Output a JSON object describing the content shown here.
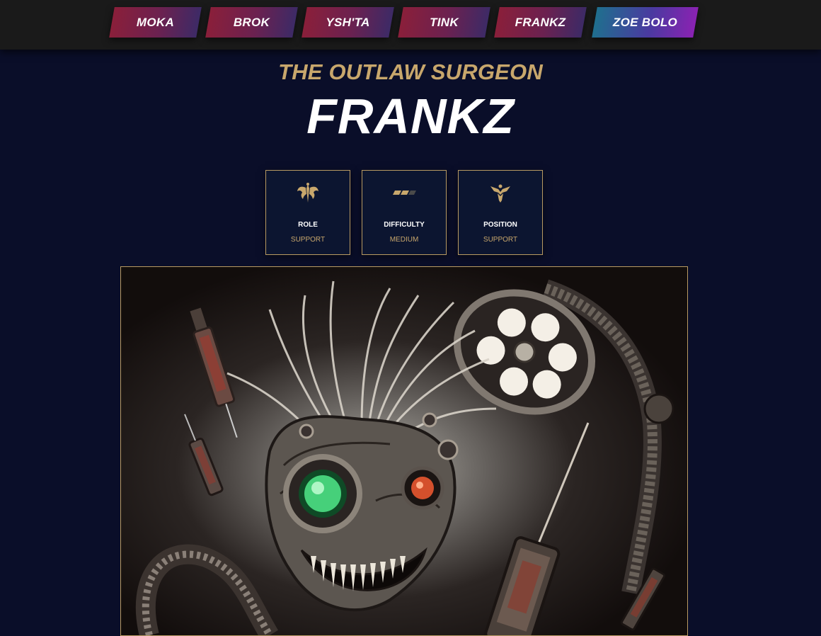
{
  "nav": {
    "tabs": [
      {
        "label": "MOKA"
      },
      {
        "label": "BROK"
      },
      {
        "label": "YSH'TA"
      },
      {
        "label": "TINK"
      },
      {
        "label": "FRANKZ"
      },
      {
        "label": "ZOE BOLO"
      }
    ]
  },
  "hero": {
    "subtitle": "THE OUTLAW SURGEON",
    "name": "FRANKZ"
  },
  "stats": [
    {
      "label": "ROLE",
      "value": "SUPPORT",
      "icon": "wings-emblem-icon"
    },
    {
      "label": "DIFFICULTY",
      "value": "MEDIUM",
      "icon": "difficulty-bars-icon",
      "level": 2,
      "max": 3
    },
    {
      "label": "POSITION",
      "value": "SUPPORT",
      "icon": "support-position-icon"
    }
  ],
  "colors": {
    "background": "#0a0e29",
    "topbar": "#1a1a1a",
    "gold": "#c8a76c",
    "tab_gradient_start": "#8a1f3a",
    "tab_gradient_end": "#3d2a66",
    "active_tab_gradient_start": "#1f6f8e",
    "active_tab_gradient_end": "#8a22b2"
  }
}
